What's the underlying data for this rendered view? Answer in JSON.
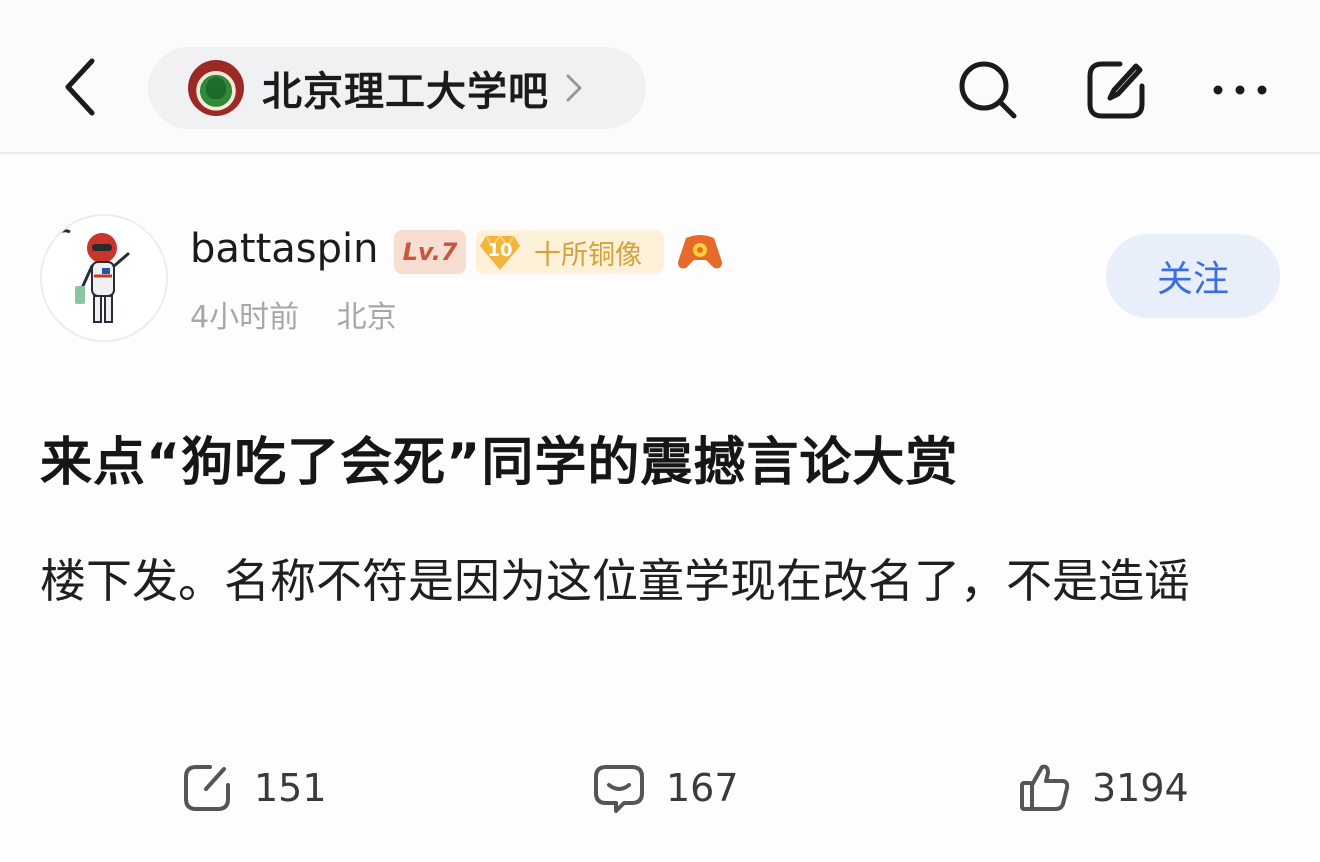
{
  "header": {
    "back_icon": "chevron-left-icon",
    "forum_name": "北京理工大学吧",
    "forum_chevron_icon": "chevron-right-icon",
    "search_icon": "search-icon",
    "edit_icon": "edit-icon",
    "more_icon": "more-icon"
  },
  "author": {
    "name": "battaspin",
    "level": "Lv.7",
    "rank_number": "10",
    "rank_title": "十所铜像",
    "time": "4小时前",
    "location": "北京",
    "follow_label": "关注"
  },
  "post": {
    "title": "来点“狗吃了会死”同学的震撼言论大赏",
    "body": "楼下发。名称不符是因为这位童学现在改名了，不是造谣"
  },
  "actions": {
    "share_count": "151",
    "comment_count": "167",
    "like_count": "3194"
  },
  "colors": {
    "accent": "#3a6ee0",
    "follow_bg": "#e9eefb",
    "level_badge": "#c8573a",
    "rank_badge": "#d7a13a"
  }
}
